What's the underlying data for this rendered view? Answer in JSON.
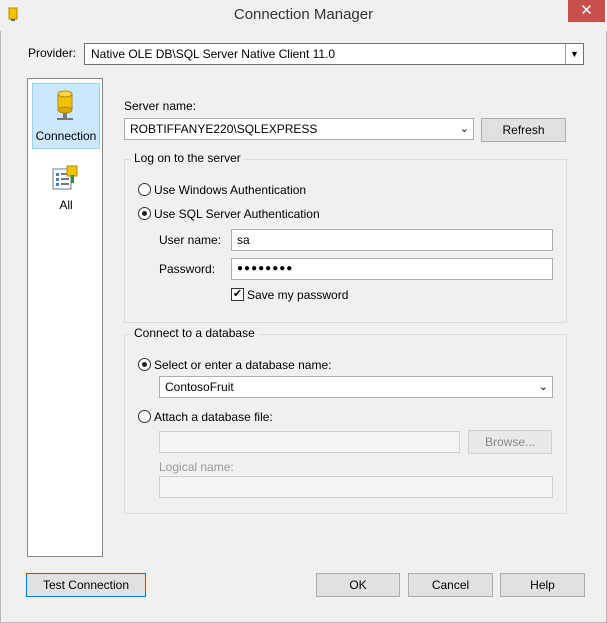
{
  "window": {
    "title": "Connection Manager",
    "close_glyph": "✕"
  },
  "provider": {
    "label": "Provider:",
    "value": "Native OLE DB\\SQL Server Native Client 11.0"
  },
  "nav": {
    "items": [
      {
        "label": "Connection",
        "icon": "database-cylinder-icon",
        "selected": true
      },
      {
        "label": "All",
        "icon": "properties-list-icon",
        "selected": false
      }
    ]
  },
  "server": {
    "label": "Server name:",
    "value": "ROBTIFFANYE220\\SQLEXPRESS",
    "refresh_label": "Refresh"
  },
  "logon": {
    "title": "Log on to the server",
    "windows_auth_label": "Use Windows Authentication",
    "sql_auth_label": "Use SQL Server Authentication",
    "selected": "sql",
    "username_label": "User name:",
    "username_value": "sa",
    "password_label": "Password:",
    "password_value": "●●●●●●●●",
    "save_password_label": "Save my password",
    "save_password_checked": true
  },
  "database": {
    "title": "Connect to a database",
    "select_label": "Select or enter a database name:",
    "database_value": "ContosoFruit",
    "attach_label": "Attach a database file:",
    "attach_value": "",
    "browse_label": "Browse...",
    "logical_name_label": "Logical name:",
    "logical_name_value": ""
  },
  "footer": {
    "test_connection_label": "Test Connection",
    "ok_label": "OK",
    "cancel_label": "Cancel",
    "help_label": "Help"
  }
}
